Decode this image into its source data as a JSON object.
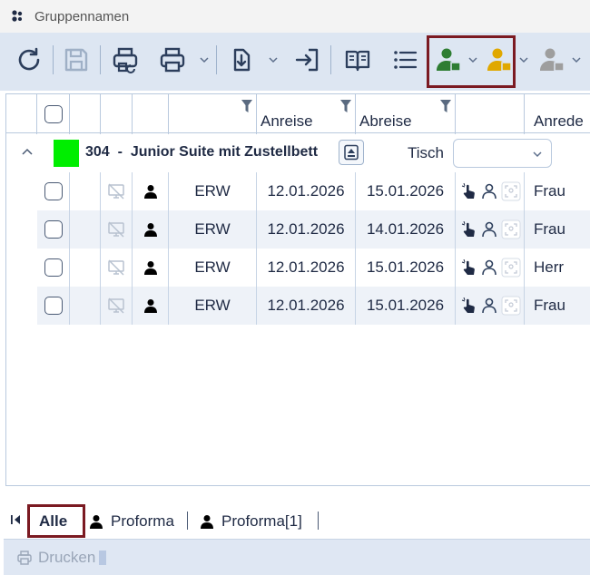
{
  "window": {
    "title": "Gruppennamen"
  },
  "toolbar": {
    "buttons": [
      {
        "name": "refresh-button",
        "icon": "refresh-icon"
      },
      {
        "name": "save-button",
        "icon": "save-icon",
        "disabled": true
      },
      {
        "name": "print-preview-button",
        "icon": "print-refresh-icon"
      },
      {
        "name": "print-button",
        "icon": "printer-icon"
      },
      {
        "name": "download-button",
        "icon": "download-icon"
      },
      {
        "name": "import-button",
        "icon": "arrow-into-box-icon"
      },
      {
        "name": "book-button",
        "icon": "open-book-icon"
      },
      {
        "name": "list-button",
        "icon": "list-icon"
      },
      {
        "name": "person-green-button",
        "icon": "person-green-icon"
      },
      {
        "name": "person-yellow-button",
        "icon": "person-yellow-icon"
      },
      {
        "name": "person-gray-button",
        "icon": "person-gray-icon"
      }
    ],
    "colors": {
      "green": "#2e7d32",
      "yellow": "#e0a800",
      "gray": "#9e9e9e",
      "highlight": "#7b1a22"
    }
  },
  "grid": {
    "headers": [
      "Anreise",
      "Abreise",
      "Anrede"
    ],
    "group": {
      "number": "304",
      "separator": "-",
      "name": "Junior Suite mit Zustellbett",
      "color": "#00ee00",
      "tisch_label": "Tisch",
      "tisch_value": ""
    },
    "rows": [
      {
        "code": "ERW",
        "anreise": "12.01.2026",
        "abreise": "15.01.2026",
        "anrede": "Frau"
      },
      {
        "code": "ERW",
        "anreise": "12.01.2026",
        "abreise": "14.01.2026",
        "anrede": "Frau"
      },
      {
        "code": "ERW",
        "anreise": "12.01.2026",
        "abreise": "15.01.2026",
        "anrede": "Herr"
      },
      {
        "code": "ERW",
        "anreise": "12.01.2026",
        "abreise": "15.01.2026",
        "anrede": "Frau"
      }
    ]
  },
  "tabs": {
    "items": [
      {
        "label": "Alle",
        "active": true
      },
      {
        "label": "Proforma",
        "icon": "person-icon"
      },
      {
        "label": "Proforma[1]",
        "icon": "person-icon"
      }
    ]
  },
  "printbar": {
    "label": "Drucken"
  }
}
